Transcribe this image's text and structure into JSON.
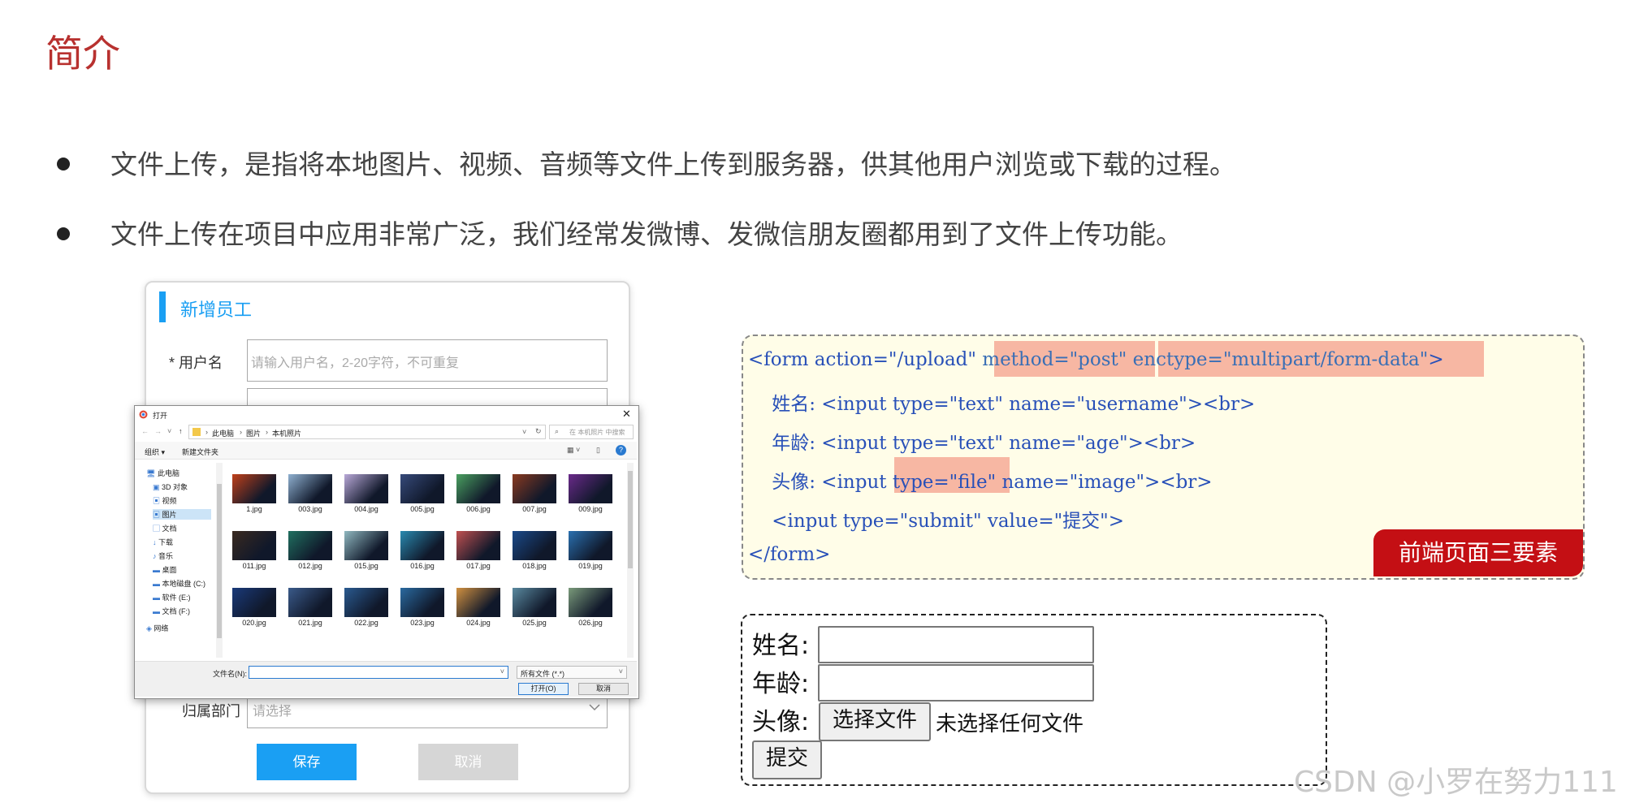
{
  "slide": {
    "title": "简介",
    "bullets": [
      "文件上传，是指将本地图片、视频、音频等文件上传到服务器，供其他用户浏览或下载的过程。",
      "文件上传在项目中应用非常广泛，我们经常发微博、发微信朋友圈都用到了文件上传功能。"
    ]
  },
  "employee_form": {
    "title": "新增员工",
    "username_label": "* 用户名",
    "username_placeholder": "请输入用户名，2-20字符，不可重复",
    "dept_label": "归属部门",
    "dept_placeholder": "请选择",
    "save_label": "保存",
    "cancel_label": "取消"
  },
  "file_dialog": {
    "title": "打开",
    "breadcrumb": [
      "此电脑",
      "图片",
      "本机照片"
    ],
    "search_placeholder": "在 本机照片 中搜索",
    "toolbar": {
      "organize": "组织 ▾",
      "new_folder": "新建文件夹"
    },
    "tree": [
      "此电脑",
      "3D 对象",
      "视频",
      "图片",
      "文档",
      "下载",
      "音乐",
      "桌面",
      "本地磁盘 (C:)",
      "软件 (E:)",
      "文档 (F:)",
      "网络"
    ],
    "files": [
      "1.jpg",
      "003.jpg",
      "004.jpg",
      "005.jpg",
      "006.jpg",
      "007.jpg",
      "009.jpg",
      "011.jpg",
      "012.jpg",
      "015.jpg",
      "016.jpg",
      "017.jpg",
      "018.jpg",
      "019.jpg",
      "020.jpg",
      "021.jpg",
      "022.jpg",
      "023.jpg",
      "024.jpg",
      "025.jpg",
      "026.jpg"
    ],
    "filename_label": "文件名(N):",
    "filetype": "所有文件 (*.*)",
    "open_label": "打开(O)",
    "cancel_label": "取消",
    "thumb_colors": [
      "#c0401a",
      "#8fb0d0",
      "#b9a9d8",
      "#364a7a",
      "#4aa060",
      "#8a3a20",
      "#6a2a8a",
      "#3a2a20",
      "#207060",
      "#90b8c0",
      "#2a8ab0",
      "#c05050",
      "#1a4a8a",
      "#2a70b0",
      "#1a3a7a",
      "#3a5a8a",
      "#2a5a90",
      "#2a6aa0",
      "#d09040",
      "#5a8aa0",
      "#7a9a7a"
    ]
  },
  "code": {
    "lines": [
      [
        "<form action=\"/upload\" ",
        "method=\"post\" ",
        "enctype=\"multipart/form-data\"",
        ">"
      ],
      [
        "    姓名: <input type=\"text\" name=\"username\"><br>"
      ],
      [
        "    年龄: <input type=\"text\" name=\"age\"><br>"
      ],
      [
        "    头像: <input type=\"file\" name=\"image\"><br>"
      ],
      [
        "    <input type=\"submit\" value=\"提交\">"
      ],
      [
        "</form>"
      ]
    ],
    "badge": "前端页面三要素"
  },
  "demo_form": {
    "name_label": "姓名:",
    "age_label": "年龄:",
    "avatar_label": "头像:",
    "choose_file_label": "选择文件",
    "no_file_text": "未选择任何文件",
    "submit_label": "提交"
  },
  "watermark": "CSDN @小罗在努力111"
}
